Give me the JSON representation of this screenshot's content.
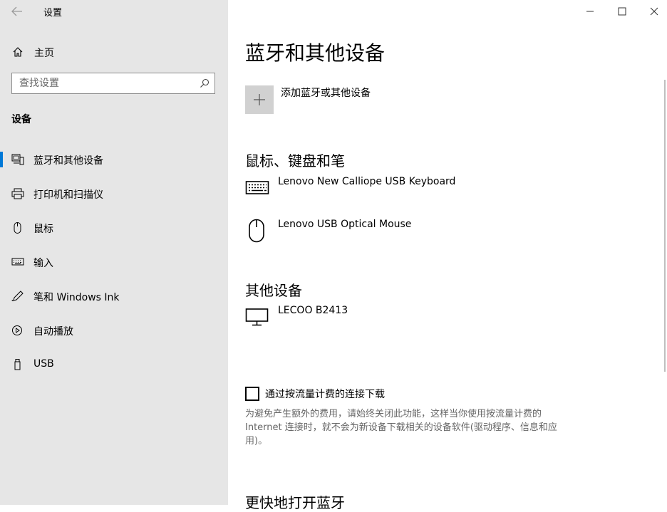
{
  "window": {
    "title": "设置",
    "controls": {
      "minimize": "minimize-icon",
      "maximize": "maximize-icon",
      "close": "close-icon"
    }
  },
  "sidebar": {
    "home_label": "主页",
    "search_placeholder": "查找设置",
    "section_title": "设备",
    "items": [
      {
        "label": "蓝牙和其他设备",
        "icon": "bluetooth-devices-icon",
        "active": true
      },
      {
        "label": "打印机和扫描仪",
        "icon": "printer-icon"
      },
      {
        "label": "鼠标",
        "icon": "mouse-icon"
      },
      {
        "label": "输入",
        "icon": "keyboard-icon"
      },
      {
        "label": "笔和 Windows Ink",
        "icon": "pen-icon"
      },
      {
        "label": "自动播放",
        "icon": "autoplay-icon"
      },
      {
        "label": "USB",
        "icon": "usb-icon"
      }
    ]
  },
  "main": {
    "title": "蓝牙和其他设备",
    "add_device_label": "添加蓝牙或其他设备",
    "groups": [
      {
        "title": "鼠标、键盘和笔",
        "devices": [
          {
            "name": "Lenovo New Calliope USB Keyboard",
            "icon": "keyboard-icon"
          },
          {
            "name": "Lenovo USB Optical Mouse",
            "icon": "mouse-icon"
          }
        ]
      },
      {
        "title": "其他设备",
        "devices": [
          {
            "name": "LECOO B2413",
            "icon": "monitor-icon"
          }
        ]
      }
    ],
    "metered_checkbox_label": "通过按流量计费的连接下载",
    "metered_checkbox_checked": false,
    "metered_description": "为避免产生额外的费用，请始终关闭此功能，这样当你使用按流量计费的Internet 连接时，就不会为新设备下载相关的设备软件(驱动程序、信息和应用)。",
    "next_section_title": "更快地打开蓝牙"
  },
  "colors": {
    "accent": "#0078d7",
    "sidebar_bg": "#e6e6e6",
    "muted_text": "#666666"
  }
}
